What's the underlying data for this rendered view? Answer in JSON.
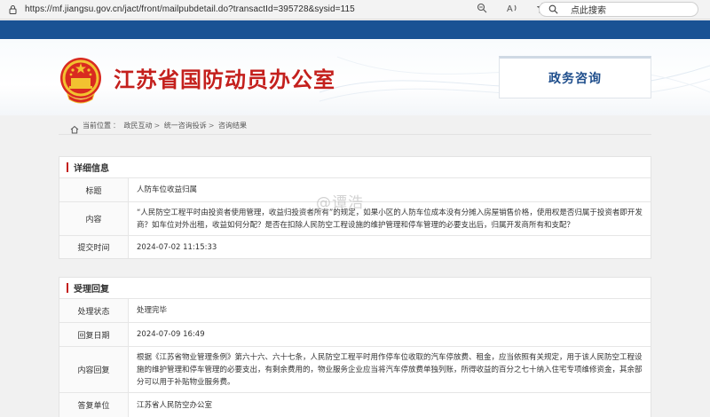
{
  "browser": {
    "url": "https://mf.jiangsu.gov.cn/jact/front/mailpubdetail.do?transactId=395728&sysid=115",
    "search_text": "点此搜索"
  },
  "site": {
    "title": "江苏省国防动员办公室",
    "tab_label": "政务咨询",
    "brand_color": "#c4201d",
    "nav_color": "#195294"
  },
  "breadcrumb": [
    "当前位置",
    "政民互动",
    "统一咨询投诉",
    "咨询结果"
  ],
  "watermark": "@谭浩",
  "detail": {
    "heading": "详细信息",
    "rows": [
      {
        "label": "标题",
        "value": "人防车位收益归属"
      },
      {
        "label": "内容",
        "value": "“人民防空工程平时由投资者使用管理，收益归投资者所有”的规定，如果小区的人防车位成本没有分摊入房屋销售价格，使用权是否归属于投资者即开发商？如车位对外出租，收益如何分配？是否在扣除人民防空工程设施的维护管理和停车管理的必要支出后，归属开发商所有和支配？"
      },
      {
        "label": "提交时间",
        "value": "2024-07-02 11:15:33"
      }
    ]
  },
  "reply": {
    "heading": "受理回复",
    "rows": [
      {
        "label": "处理状态",
        "value": "处理完毕"
      },
      {
        "label": "回复日期",
        "value": "2024-07-09 16:49"
      },
      {
        "label": "内容回复",
        "value": "根据《江苏省物业管理条例》第六十六、六十七条，人民防空工程平时用作停车位收取的汽车停放费、租金，应当依照有关规定，用于该人民防空工程设施的维护管理和停车管理的必要支出，有剩余费用的，物业服务企业应当将汽车停放费单独列账，所得收益的百分之七十纳入住宅专项维修资金，其余部分可以用于补贴物业服务费。"
      },
      {
        "label": "答复单位",
        "value": "江苏省人民防空办公室"
      }
    ]
  }
}
